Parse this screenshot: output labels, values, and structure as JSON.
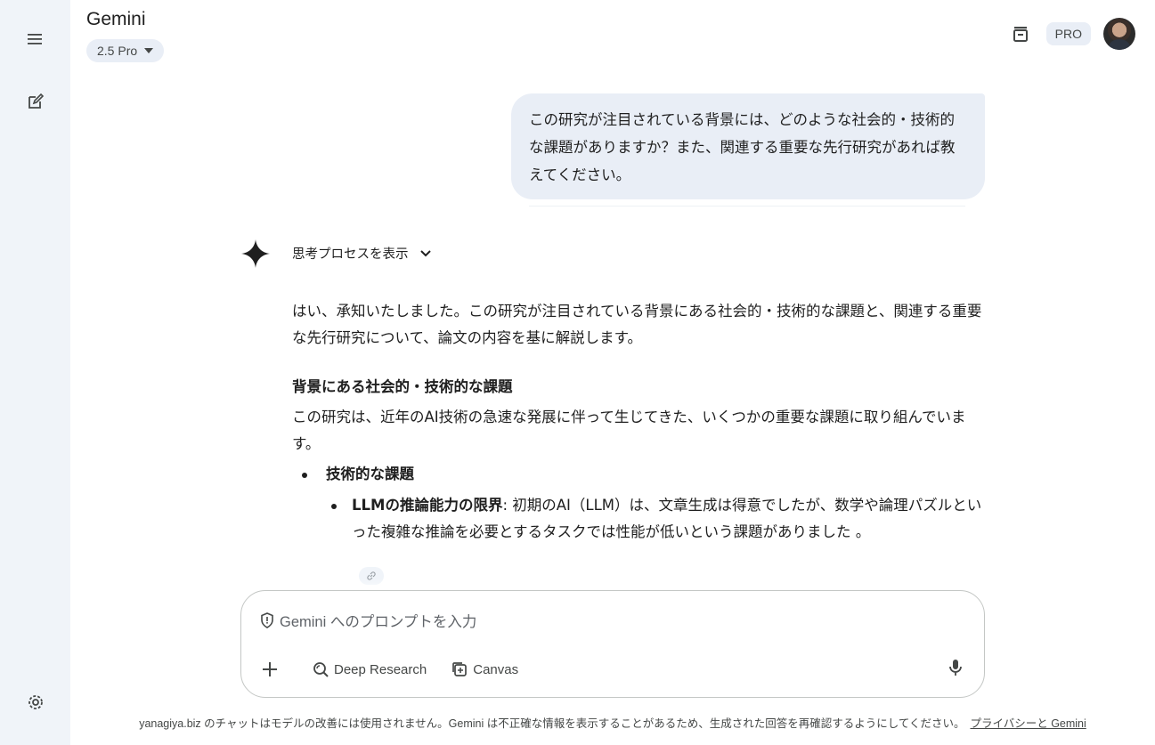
{
  "app": {
    "title": "Gemini",
    "model": "2.5 Pro",
    "pro_badge": "PRO"
  },
  "sidebar": {
    "menu_icon": "menu-icon",
    "new_chat_icon": "edit-icon",
    "settings_icon": "gear-icon"
  },
  "header": {
    "temp_chat_icon": "temporary-chat-icon"
  },
  "conversation": {
    "user_message": "この研究が注目されている背景には、どのような社会的・技術的な課題がありますか？また、関連する重要な先行研究があれば教えてください。",
    "thinking_label": "思考プロセスを表示",
    "response": {
      "intro": "はい、承知いたしました。この研究が注目されている背景にある社会的・技術的な課題と、関連する重要な先行研究について、論文の内容を基に解説します。",
      "heading": "背景にある社会的・技術的な課題",
      "paragraph": "この研究は、近年のAI技術の急速な発展に伴って生じてきた、いくつかの重要な課題に取り組んでいます。",
      "bullet1": "技術的な課題",
      "sub_bullet_bold": "LLMの推論能力の限界",
      "sub_bullet_text": ": 初期のAI（LLM）は、文章生成は得意でしたが、数学や論理パズルといった複雑な推論を必要とするタスクでは性能が低いという課題がありました 。"
    }
  },
  "input": {
    "placeholder": "Gemini へのプロンプトを入力",
    "tools": {
      "deep_research": "Deep Research",
      "canvas": "Canvas"
    }
  },
  "footer": {
    "text": "yanagiya.biz のチャットはモデルの改善には使用されません。Gemini は不正確な情報を表示することがあるため、生成された回答を再確認するようにしてください。",
    "link": "プライバシーと Gemini"
  }
}
